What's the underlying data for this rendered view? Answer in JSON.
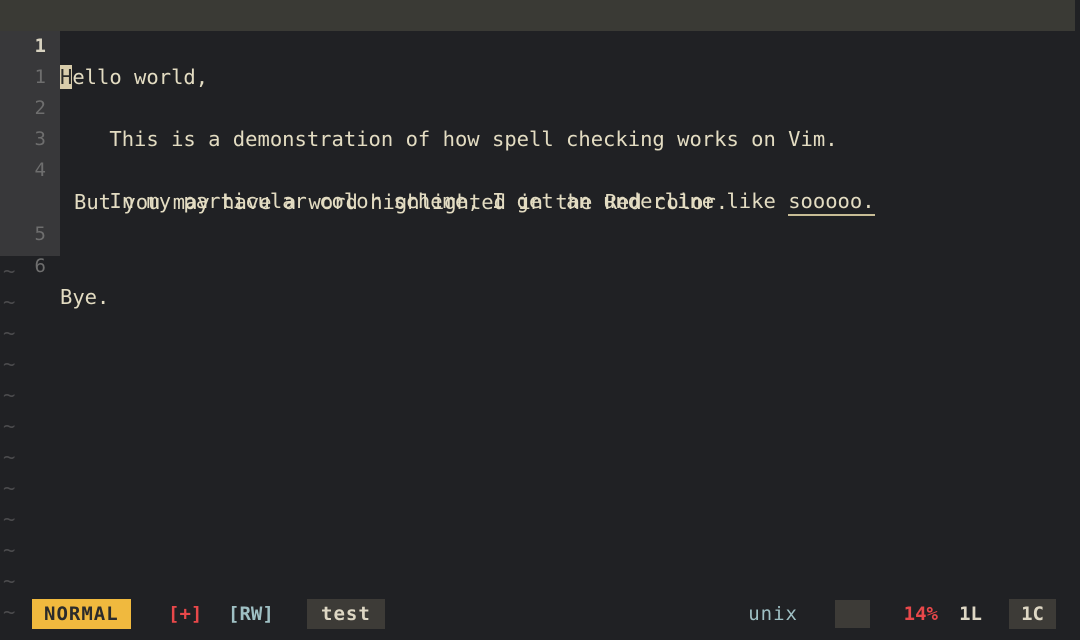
{
  "editor": {
    "app": "vim",
    "cursor": {
      "line": 1,
      "column": 1,
      "char": "H"
    },
    "gutter": {
      "numbering": "relative",
      "current_line_number": "1",
      "relative_numbers": [
        "1",
        "2",
        "3",
        "4",
        "5",
        "6"
      ],
      "filler_char": "~",
      "filler_count": 12
    },
    "lines": [
      {
        "number": "1",
        "is_current": true,
        "cursor_char": "H",
        "text_after_cursor": "ello world,",
        "full_text": "Hello world,"
      },
      {
        "number": "1",
        "is_current": false,
        "full_text": ""
      },
      {
        "number": "2",
        "is_current": false,
        "full_text": "    This is a demonstration of how spell checking works on Vim."
      },
      {
        "number": "3",
        "is_current": false,
        "full_text": ""
      },
      {
        "number": "4",
        "is_current": false,
        "full_text": "    In my particular color scheme, I get an underline like sooooo. But you may have a word highlighted in the Red color.",
        "segment_before_misspelling": "    In my particular color scheme, I get an underline like ",
        "misspelled_word": "sooooo.",
        "wrapped_continuation": "But you may have a word highlighted in the Red color."
      },
      {
        "number": "5",
        "is_current": false,
        "full_text": ""
      },
      {
        "number": "6",
        "is_current": false,
        "full_text": "Bye."
      }
    ]
  },
  "statusline": {
    "mode": "NORMAL",
    "modified_flag": "[+]",
    "readwrite_flag": "[RW]",
    "filename": "test",
    "fileformat": "unix",
    "filetype": "",
    "percent": "14%",
    "total_lines": "1L",
    "column": "1C"
  },
  "colors": {
    "background": "#202124",
    "gutter_background": "#38383a",
    "cursorline": "#3a3a35",
    "foreground": "#e3dcc2",
    "line_number": "#6e6e6e",
    "line_number_current": "#d8d2c0",
    "cursor_block": "#d8ccaa",
    "tilde": "#4b4b4d",
    "mode_badge": "#f0b93e",
    "modified": "#e8484a",
    "readwrite": "#9fc0c4",
    "filename_box": "#3d3b37",
    "spell_underline": "#c8bd96"
  }
}
